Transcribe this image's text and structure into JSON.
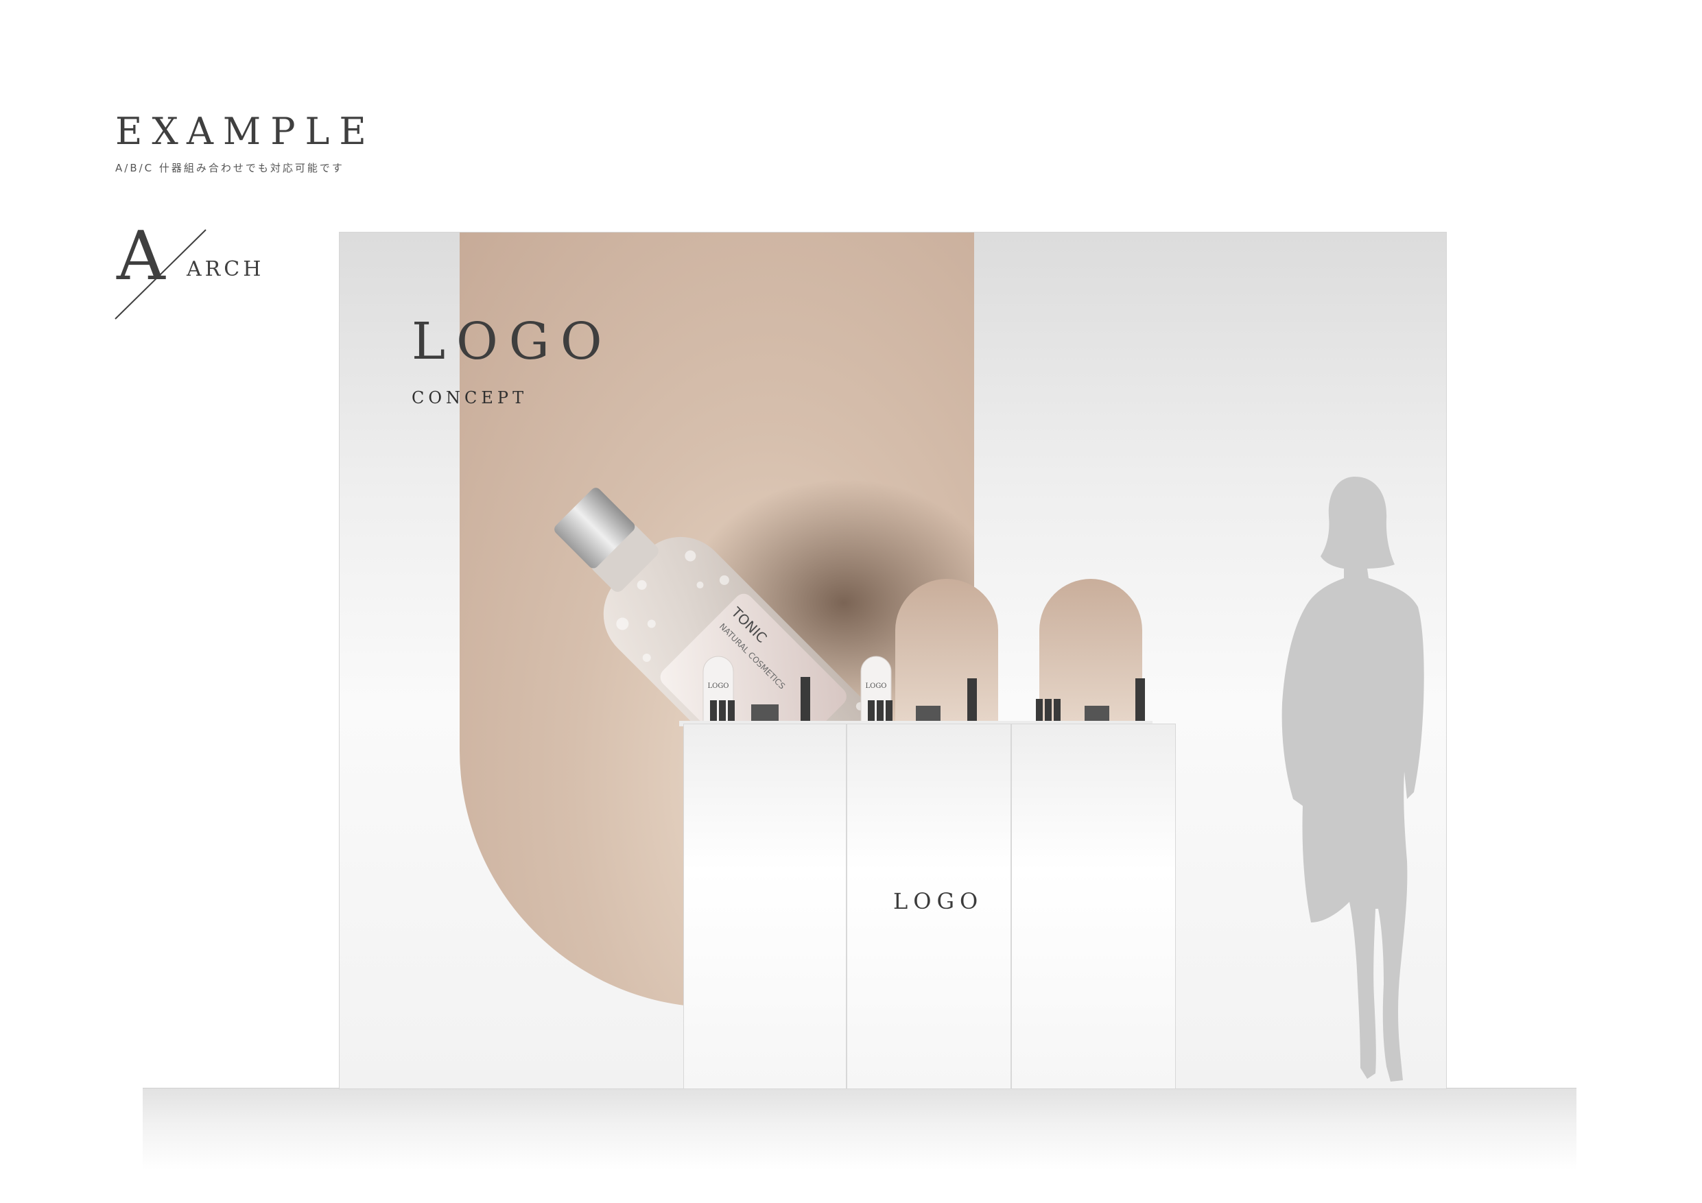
{
  "header": {
    "title": "EXAMPLE",
    "subtitle": "A/B/C 什器組み合わせでも対応可能です"
  },
  "type_mark": {
    "letter": "A",
    "name": "ARCH"
  },
  "wall": {
    "logo": "LOGO",
    "concept": "CONCEPT"
  },
  "bottle": {
    "label_title": "TONIC",
    "label_sub": "NATURAL COSMETICS"
  },
  "display_cards": {
    "logo": "LOGO"
  },
  "counter": {
    "logo": "LOGO"
  },
  "colors": {
    "accent_beige": "#c9ae9b",
    "text_dark": "#3f3f3f",
    "silhouette": "#c9c9c9"
  }
}
